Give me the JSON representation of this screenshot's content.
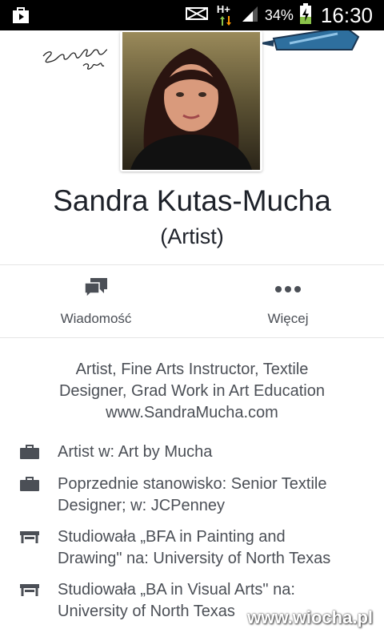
{
  "status_bar": {
    "network": "H+",
    "battery": "34%",
    "time": "16:30"
  },
  "profile": {
    "signature": "SandraMucha",
    "name": "Sandra Kutas-Mucha",
    "role": "(Artist)"
  },
  "actions": {
    "message_label": "Wiadomość",
    "more_label": "Więcej"
  },
  "bio": {
    "line1": "Artist, Fine Arts Instructor, Textile",
    "line2": "Designer, Grad Work in Art Education",
    "line3": "www.SandraMucha.com"
  },
  "info": [
    {
      "icon": "briefcase-icon",
      "line1": "Artist w: Art by Mucha",
      "line2": ""
    },
    {
      "icon": "briefcase-icon",
      "line1": "Poprzednie stanowisko: Senior Textile",
      "line2": "Designer; w: JCPenney"
    },
    {
      "icon": "graduation-cap-icon",
      "line1": "Studiowała „BFA in Painting and",
      "line2": "Drawing\" na: University of North Texas"
    },
    {
      "icon": "graduation-cap-icon",
      "line1": "Studiowała „BA in Visual Arts\" na:",
      "line2": "University of North Texas"
    }
  ],
  "watermark": "www.wiocha.pl",
  "colors": {
    "status_bar": "#000000",
    "text_primary": "#1d2129",
    "text_secondary": "#4b4f56",
    "icon": "#4b4f56"
  }
}
